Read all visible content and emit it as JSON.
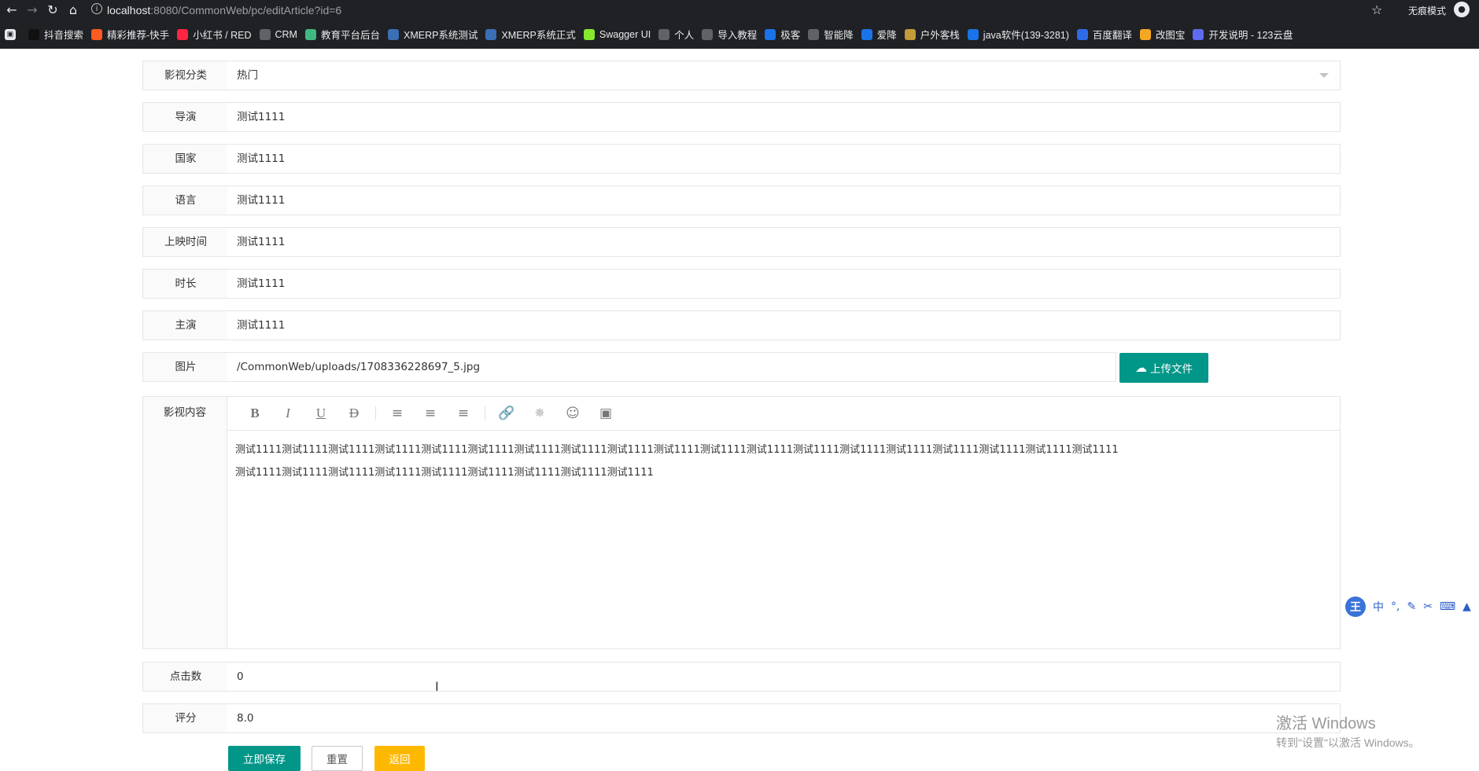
{
  "browser": {
    "url_host": "localhost",
    "url_path": ":8080/CommonWeb/pc/editArticle?id=6",
    "incognito_label": "无痕模式",
    "bookmarks": [
      {
        "label": "抖音搜索",
        "icon": "tiktok-icon",
        "color": "#111111"
      },
      {
        "label": "精彩推荐-快手",
        "icon": "kuaishou-icon",
        "color": "#ff5a1f"
      },
      {
        "label": "小红书 / RED",
        "icon": "xiaohongshu-icon",
        "color": "#ff2442"
      },
      {
        "label": "CRM",
        "icon": "globe-icon",
        "color": "#5f6368"
      },
      {
        "label": "教育平台后台",
        "icon": "vue-icon",
        "color": "#41b883"
      },
      {
        "label": "XMERP系统测试",
        "icon": "xmerp-icon",
        "color": "#3b6fb6"
      },
      {
        "label": "XMERP系统正式",
        "icon": "xmerp-icon",
        "color": "#3b6fb6"
      },
      {
        "label": "Swagger UI",
        "icon": "swagger-icon",
        "color": "#85ea2d"
      },
      {
        "label": "个人",
        "icon": "globe-icon",
        "color": "#5f6368"
      },
      {
        "label": "导入教程",
        "icon": "globe-icon",
        "color": "#5f6368"
      },
      {
        "label": "极客",
        "icon": "rocket-icon",
        "color": "#1a73e8"
      },
      {
        "label": "智能降",
        "icon": "globe-icon",
        "color": "#5f6368"
      },
      {
        "label": "爱降",
        "icon": "shield-icon",
        "color": "#1a73e8"
      },
      {
        "label": "户外客栈",
        "icon": "outdoor-icon",
        "color": "#c49a3a"
      },
      {
        "label": "java软件(139-3281)",
        "icon": "tv-icon",
        "color": "#1a73e8"
      },
      {
        "label": "百度翻译",
        "icon": "translate-icon",
        "color": "#2e6be6"
      },
      {
        "label": "改图宝",
        "icon": "image-edit-icon",
        "color": "#f5a623"
      },
      {
        "label": "开发说明 - 123云盘",
        "icon": "cloud-disk-icon",
        "color": "#5c6bf0"
      }
    ]
  },
  "form": {
    "category_label": "影视分类",
    "category_value": "热门",
    "director_label": "导演",
    "director_value": "测试1111",
    "country_label": "国家",
    "country_value": "测试1111",
    "language_label": "语言",
    "language_value": "测试1111",
    "release_label": "上映时间",
    "release_value": "测试1111",
    "duration_label": "时长",
    "duration_value": "测试1111",
    "cast_label": "主演",
    "cast_value": "测试1111",
    "image_label": "图片",
    "image_value": "/CommonWeb/uploads/1708336228697_5.jpg",
    "upload_label": "上传文件",
    "content_label": "影视内容",
    "content_line1": "测试1111测试1111测试1111测试1111测试1111测试1111测试1111测试1111测试1111测试1111测试1111测试1111测试1111测试1111测试1111测试1111测试1111测试1111测试1111",
    "content_line2": "测试1111测试1111测试1111测试1111测试1111测试1111测试1111测试1111测试1111",
    "clicks_label": "点击数",
    "clicks_value": "0",
    "rating_label": "评分",
    "rating_value": "8.0"
  },
  "actions": {
    "save_label": "立即保存",
    "reset_label": "重置",
    "back_label": "返回"
  },
  "ime": {
    "logo": "王",
    "mode": "中"
  },
  "watermark": {
    "line1": "激活 Windows",
    "line2": "转到\"设置\"以激活 Windows。"
  }
}
